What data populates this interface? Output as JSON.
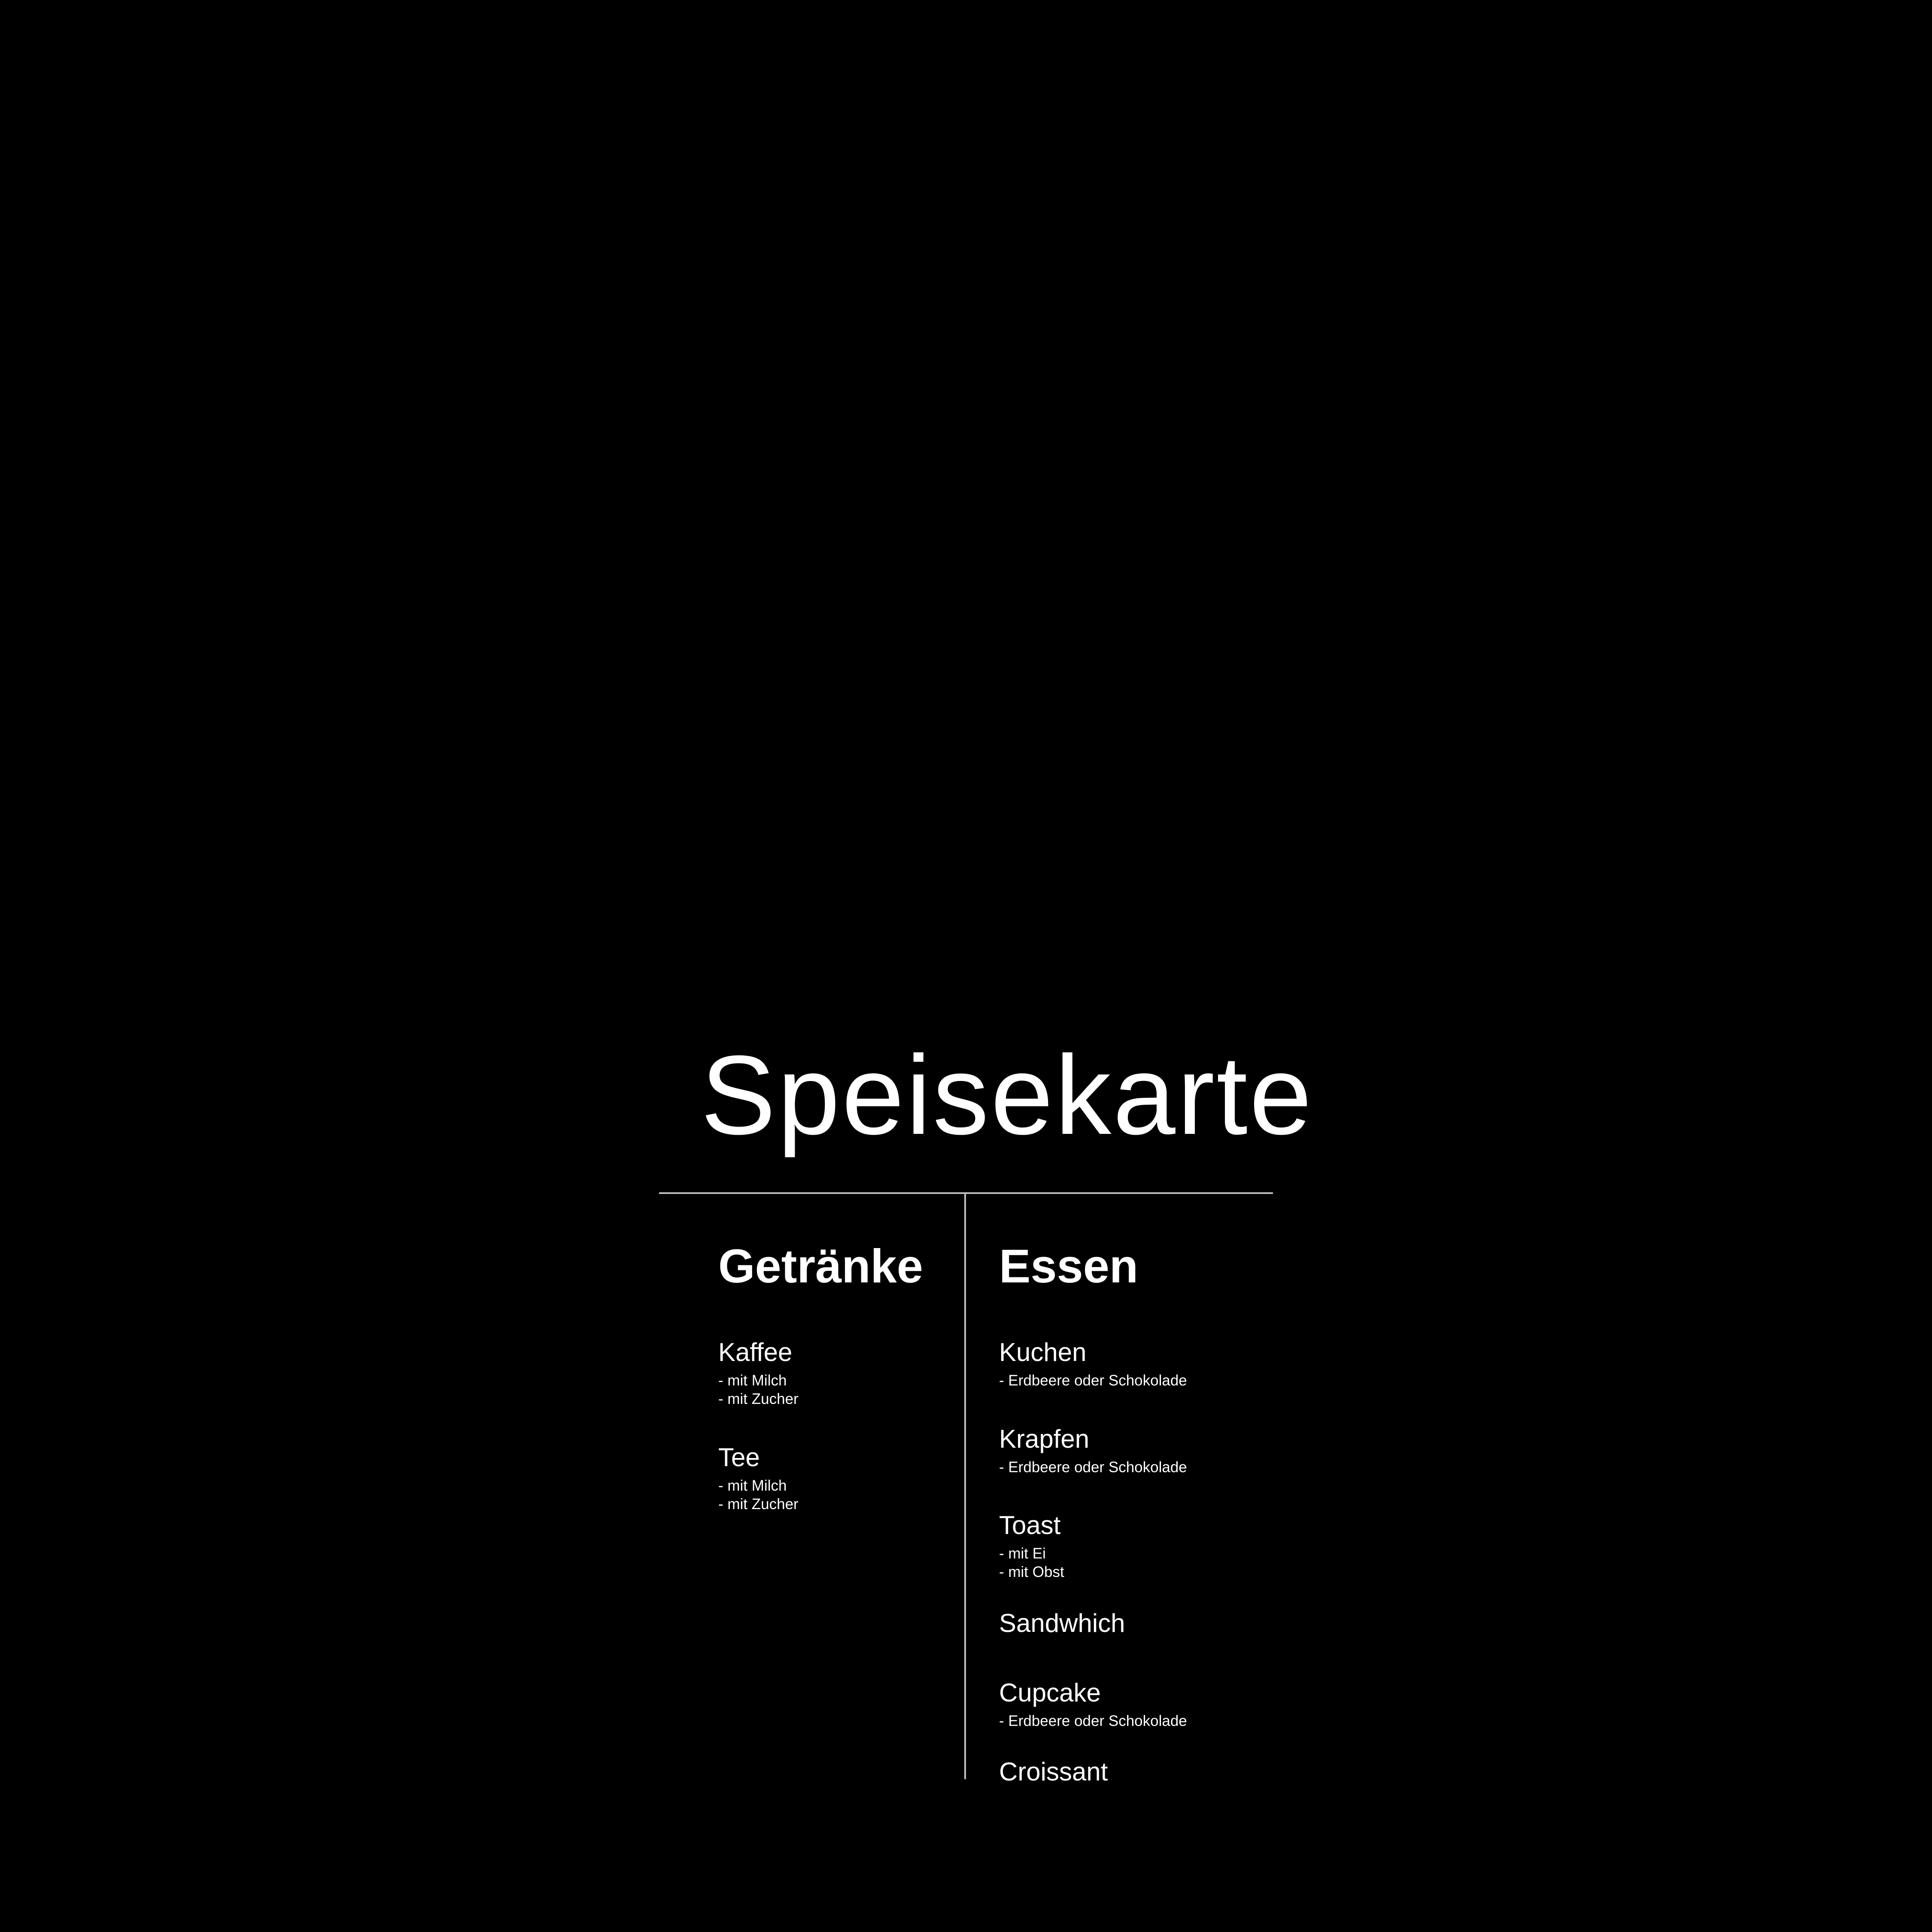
{
  "title": "Speisekarte",
  "colors": {
    "background": "#000000",
    "text": "#ffffff",
    "rule": "#bdbdbd"
  },
  "drinks": {
    "heading": "Getränke",
    "items": [
      {
        "name": "Kaffee",
        "options": [
          "- mit Milch",
          "- mit Zucher"
        ]
      },
      {
        "name": "Tee",
        "options": [
          "- mit Milch",
          "- mit Zucher"
        ]
      }
    ]
  },
  "food": {
    "heading": "Essen",
    "items": [
      {
        "name": "Kuchen",
        "options": [
          "- Erdbeere oder Schokolade"
        ]
      },
      {
        "name": "Krapfen",
        "options": [
          "- Erdbeere oder Schokolade"
        ]
      },
      {
        "name": "Toast",
        "options": [
          "- mit Ei",
          "- mit Obst"
        ]
      },
      {
        "name": "Sandwhich",
        "options": []
      },
      {
        "name": "Cupcake",
        "options": [
          "- Erdbeere oder Schokolade"
        ]
      },
      {
        "name": "Croissant",
        "options": []
      }
    ]
  }
}
